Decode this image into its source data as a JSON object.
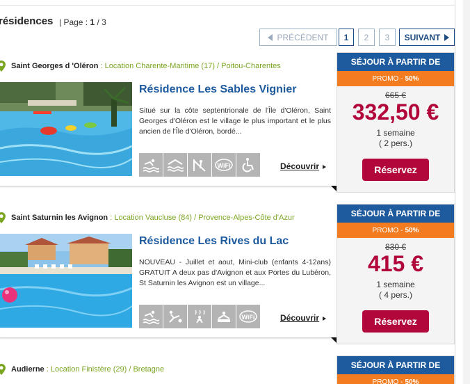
{
  "header": {
    "title": "résidences",
    "page_label": "| Page : ",
    "page_current": "1",
    "page_total": " / 3"
  },
  "pager": {
    "prev_label": "PRÉCÉDENT",
    "pages": [
      "1",
      "2",
      "3"
    ],
    "next_label": "SUIVANT"
  },
  "listings": [
    {
      "city": "Saint Georges d 'Oléron",
      "location": " : Location Charente-Maritime (17) / Poitou-Charentes",
      "name": "Résidence Les Sables Vignier",
      "description": "Situé sur la côte septentrionale de l'Île d'Oléron, Saint Georges d'Oléron est le village le plus important et le plus ancien de l'Île d'Oléron, bordé...",
      "amenities": [
        "pool-icon",
        "waves-icon",
        "playground-icon",
        "wifi-icon",
        "accessibility-icon"
      ],
      "cta": "Découvrir",
      "price_header": "SÉJOUR À PARTIR DE",
      "promo_label": "PROMO -",
      "promo_value": "50%",
      "old_price": "665 €",
      "price": "332,50 €",
      "duration": "1 semaine",
      "people": "( 2 pers.)",
      "reserve_label": "Réservez"
    },
    {
      "city": "Saint Saturnin les Avignon",
      "location": " : Location Vaucluse (84) / Provence-Alpes-Côte d'Azur",
      "name": "Résidence Les Rives du Lac",
      "description": "NOUVEAU - Juillet et aout, Mini-club (enfants 4-12ans) GRATUIT A deux pas d'Avignon et aux Portes du Lubéron, St Saturnin les Avignon est un village...",
      "amenities": [
        "pool-icon",
        "sport-icon",
        "hammam-icon",
        "spa-icon",
        "wifi-icon"
      ],
      "cta": "Découvrir",
      "price_header": "SÉJOUR À PARTIR DE",
      "promo_label": "PROMO -",
      "promo_value": "50%",
      "old_price": "830 €",
      "price": "415 €",
      "duration": "1 semaine",
      "people": "( 4 pers.)",
      "reserve_label": "Réservez"
    },
    {
      "city": "Audierne",
      "location": " : Location Finistère (29) / Bretagne",
      "price_header": "SÉJOUR À PARTIR DE",
      "promo_label": "PROMO -",
      "promo_value": "50%"
    }
  ],
  "colors": {
    "brand_blue": "#1d5a9e",
    "promo_orange": "#f47c20",
    "price_red": "#b2073b",
    "location_green": "#7aa521"
  }
}
